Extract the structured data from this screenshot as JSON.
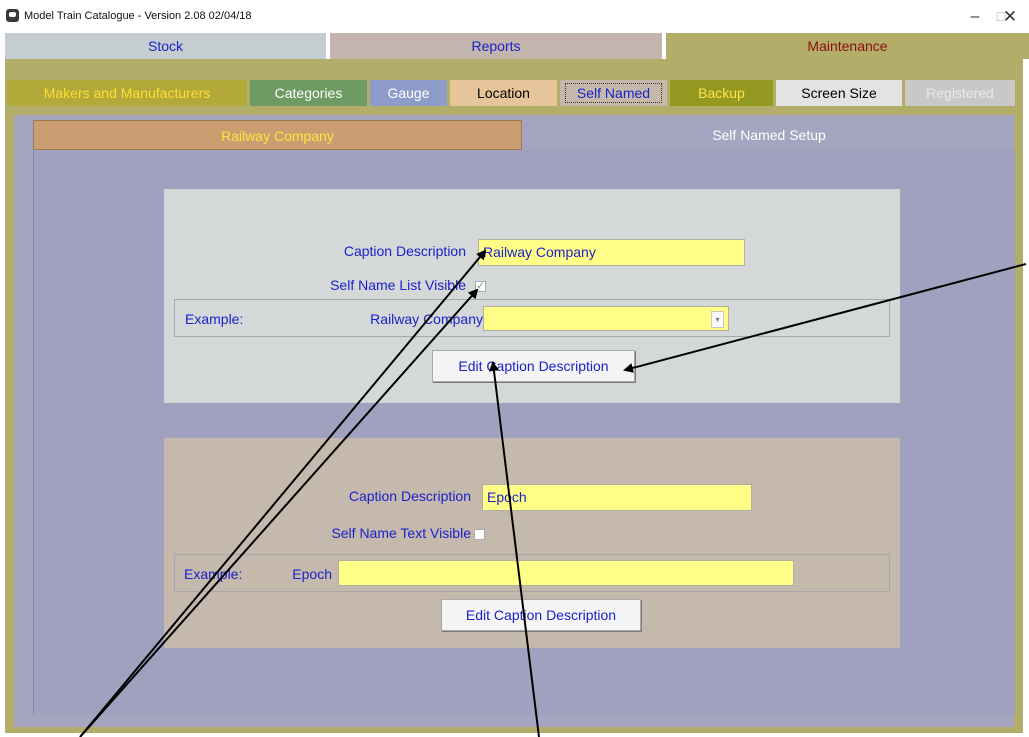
{
  "window": {
    "title": "Model Train Catalogue -  Version 2.08  02/04/18",
    "minimize_glyph": "–",
    "maximize_glyph": "☐",
    "close_glyph": "✕"
  },
  "main_tabs": [
    {
      "label": "Stock"
    },
    {
      "label": "Reports"
    },
    {
      "label": "Maintenance"
    }
  ],
  "sub_tabs": [
    {
      "label": "Makers and Manufacturers"
    },
    {
      "label": "Categories"
    },
    {
      "label": "Gauge"
    },
    {
      "label": "Location"
    },
    {
      "label": "Self Named"
    },
    {
      "label": "Backup"
    },
    {
      "label": "Screen Size"
    },
    {
      "label": "Registered"
    }
  ],
  "inner_tabs": [
    {
      "label": "Railway Company"
    },
    {
      "label": "Self Named Setup"
    }
  ],
  "section1": {
    "caption_label": "Caption Description",
    "caption_value": "Railway Company",
    "visible_label": "Self Name List Visible",
    "visible_checked": true,
    "example_label": "Example:",
    "example_field_label": "Railway Company",
    "example_value": "",
    "edit_button": "Edit Caption Description"
  },
  "section2": {
    "caption_label": "Caption Description",
    "caption_value": "Epoch",
    "visible_label": "Self Name Text Visible",
    "visible_checked": false,
    "example_label": "Example:",
    "example_field_label": "Epoch",
    "example_value": "",
    "edit_button": "Edit Caption Description"
  }
}
